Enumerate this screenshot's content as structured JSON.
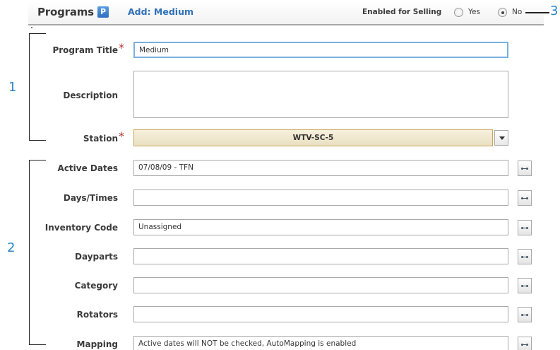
{
  "header": {
    "app_title": "Programs",
    "app_badge": "P",
    "breadcrumb": "Add: Medium",
    "enabled_for_selling_label": "Enabled for Selling",
    "enabled_for_selling_options": [
      "Yes",
      "No"
    ],
    "enabled_for_selling_selected": "No"
  },
  "callouts": [
    "1",
    "2",
    "3"
  ],
  "form": {
    "program_title": {
      "label": "Program Title",
      "value": "Medium",
      "required": true
    },
    "description": {
      "label": "Description",
      "value": ""
    },
    "station": {
      "label": "Station",
      "value": "WTV-SC-5",
      "required": true
    },
    "active_dates": {
      "label": "Active Dates",
      "value": "07/08/09 - TFN"
    },
    "days_times": {
      "label": "Days/Times",
      "value": ""
    },
    "inventory_code": {
      "label": "Inventory Code",
      "value": "Unassigned"
    },
    "dayparts": {
      "label": "Dayparts",
      "value": ""
    },
    "category": {
      "label": "Category",
      "value": ""
    },
    "rotators": {
      "label": "Rotators",
      "value": ""
    },
    "mapping": {
      "label": "Mapping",
      "value": "Active dates will NOT be checked, AutoMapping is enabled"
    }
  },
  "colors": {
    "accent": "#2f6fb8",
    "callout": "#2a86c6",
    "required": "#b03030",
    "station_bg": "#f2e9d0",
    "focus_border": "#7ab0e0"
  }
}
